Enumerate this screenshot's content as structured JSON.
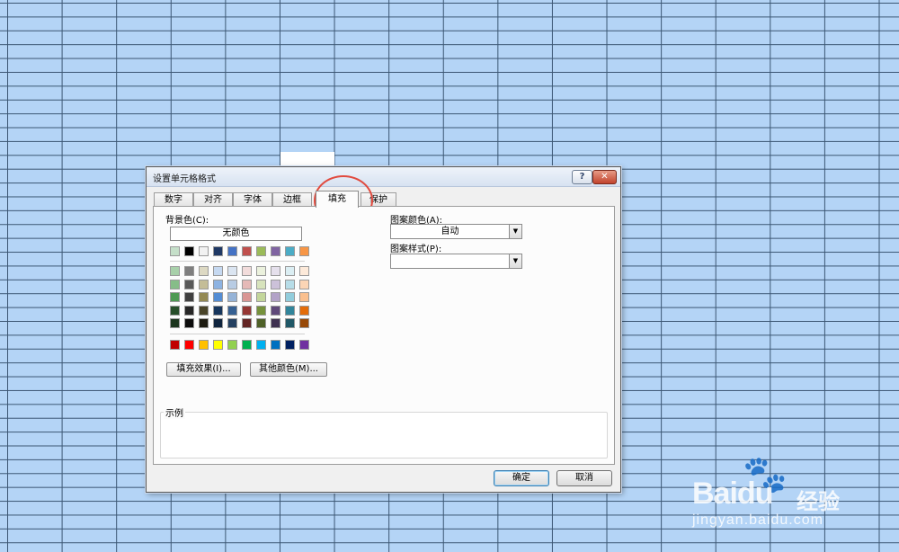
{
  "dialog": {
    "title": "设置单元格格式",
    "help_label": "?",
    "close_label": "✕"
  },
  "tabs": [
    {
      "label": "数字"
    },
    {
      "label": "对齐"
    },
    {
      "label": "字体"
    },
    {
      "label": "边框"
    },
    {
      "label": "填充",
      "active": true,
      "highlighted": true
    },
    {
      "label": "保护"
    }
  ],
  "fill": {
    "background_label": "背景色(C):",
    "no_color_label": "无颜色",
    "theme_top_row": [
      "#c5dfc9",
      "#000000",
      "#f2f2f2",
      "#1f3864",
      "#4472c4",
      "#c0504d",
      "#9bbb59",
      "#8064a2",
      "#4bacc6",
      "#f79646"
    ],
    "theme_shades": [
      [
        "#a8d0aa",
        "#7f7f7f",
        "#ddd9c3",
        "#c6d9f1",
        "#dbe5f1",
        "#f2dcdb",
        "#ebf1dd",
        "#e5e0ec",
        "#dbeef3",
        "#fdeada"
      ],
      [
        "#86bd88",
        "#595959",
        "#c4bd97",
        "#8db3e2",
        "#b8cce4",
        "#e5b9b7",
        "#d7e3bc",
        "#ccc1d9",
        "#b7dde8",
        "#fbd5b5"
      ],
      [
        "#4e9a53",
        "#3f3f3f",
        "#938953",
        "#548dd4",
        "#95b3d7",
        "#d99694",
        "#c3d69b",
        "#b2a2c7",
        "#92cddc",
        "#fac08f"
      ],
      [
        "#274e2a",
        "#262626",
        "#494429",
        "#17365d",
        "#366092",
        "#953734",
        "#76923c",
        "#5f497a",
        "#31859b",
        "#e36c09"
      ],
      [
        "#1b351d",
        "#0c0c0c",
        "#1d1b10",
        "#0f243e",
        "#244061",
        "#632423",
        "#4f6128",
        "#3f3151",
        "#205867",
        "#974806"
      ]
    ],
    "standard_colors": [
      "#c00000",
      "#ff0000",
      "#ffc000",
      "#ffff00",
      "#92d050",
      "#00b050",
      "#00b0f0",
      "#0070c0",
      "#002060",
      "#7030a0"
    ],
    "fill_effects_label": "填充效果(I)...",
    "more_colors_label": "其他颜色(M)...",
    "pattern_color_label": "图案颜色(A):",
    "pattern_color_value": "自动",
    "pattern_style_label": "图案样式(P):",
    "pattern_style_value": "",
    "sample_label": "示例"
  },
  "footer": {
    "ok_label": "确定",
    "cancel_label": "取消"
  },
  "watermark": {
    "logo": "Bai",
    "logo_suffix": "du",
    "cn": "经验",
    "url": "jingyan.baidu.com"
  },
  "colors": {
    "sheet_bg": "#b4d4f6",
    "grid_line": "#3b5673",
    "highlight_ring": "#e14a3e"
  }
}
